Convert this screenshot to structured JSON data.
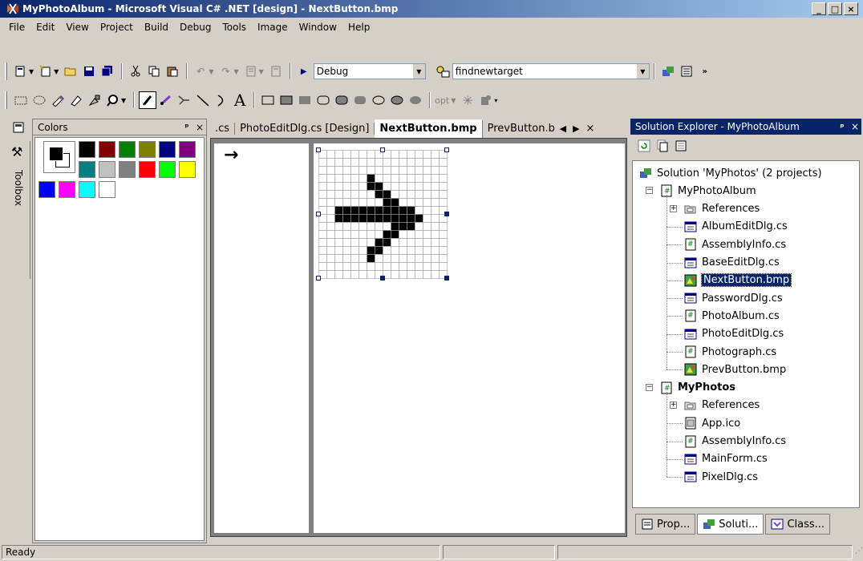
{
  "window": {
    "title": "MyPhotoAlbum - Microsoft Visual C# .NET [design] - NextButton.bmp",
    "minimize": "_",
    "maximize": "□",
    "close": "×"
  },
  "menu": [
    "File",
    "Edit",
    "View",
    "Project",
    "Build",
    "Debug",
    "Tools",
    "Image",
    "Window",
    "Help"
  ],
  "toolbar": {
    "config_value": "Debug",
    "find_value": "findnewtarget",
    "text_tool": "A",
    "opt_label": "opt"
  },
  "colors_panel": {
    "title": "Colors",
    "pin": "ᵖ",
    "close": "×",
    "palette": [
      "#000000",
      "#800000",
      "#008000",
      "#808000",
      "#000080",
      "#800080",
      "#008080",
      "#c0c0c0",
      "#808080",
      "#ff0000",
      "#00ff00",
      "#ffff00",
      "#0000ff",
      "#ff00ff",
      "#00ffff",
      "#ffffff"
    ]
  },
  "toolbox": {
    "label": "Toolbox"
  },
  "editor": {
    "tabs": [
      ".cs",
      "PhotoEditDlg.cs [Design]",
      "NextButton.bmp",
      "PrevButton.b"
    ],
    "active_tab": "NextButton.bmp",
    "preview_glyph": "→"
  },
  "solution_explorer": {
    "title": "Solution Explorer - MyPhotoAlbum",
    "solution": "Solution 'MyPhotos' (2 projects)",
    "projects": [
      {
        "name": "MyPhotoAlbum",
        "items": [
          "References",
          "AlbumEditDlg.cs",
          "AssemblyInfo.cs",
          "BaseEditDlg.cs",
          "NextButton.bmp",
          "PasswordDlg.cs",
          "PhotoAlbum.cs",
          "PhotoEditDlg.cs",
          "Photograph.cs",
          "PrevButton.bmp"
        ]
      },
      {
        "name": "MyPhotos",
        "items": [
          "References",
          "App.ico",
          "AssemblyInfo.cs",
          "MainForm.cs",
          "PixelDlg.cs"
        ]
      }
    ],
    "selected_item": "NextButton.bmp",
    "bottom_tabs": [
      "Prop...",
      "Soluti...",
      "Class..."
    ]
  },
  "status": {
    "text": "Ready"
  }
}
